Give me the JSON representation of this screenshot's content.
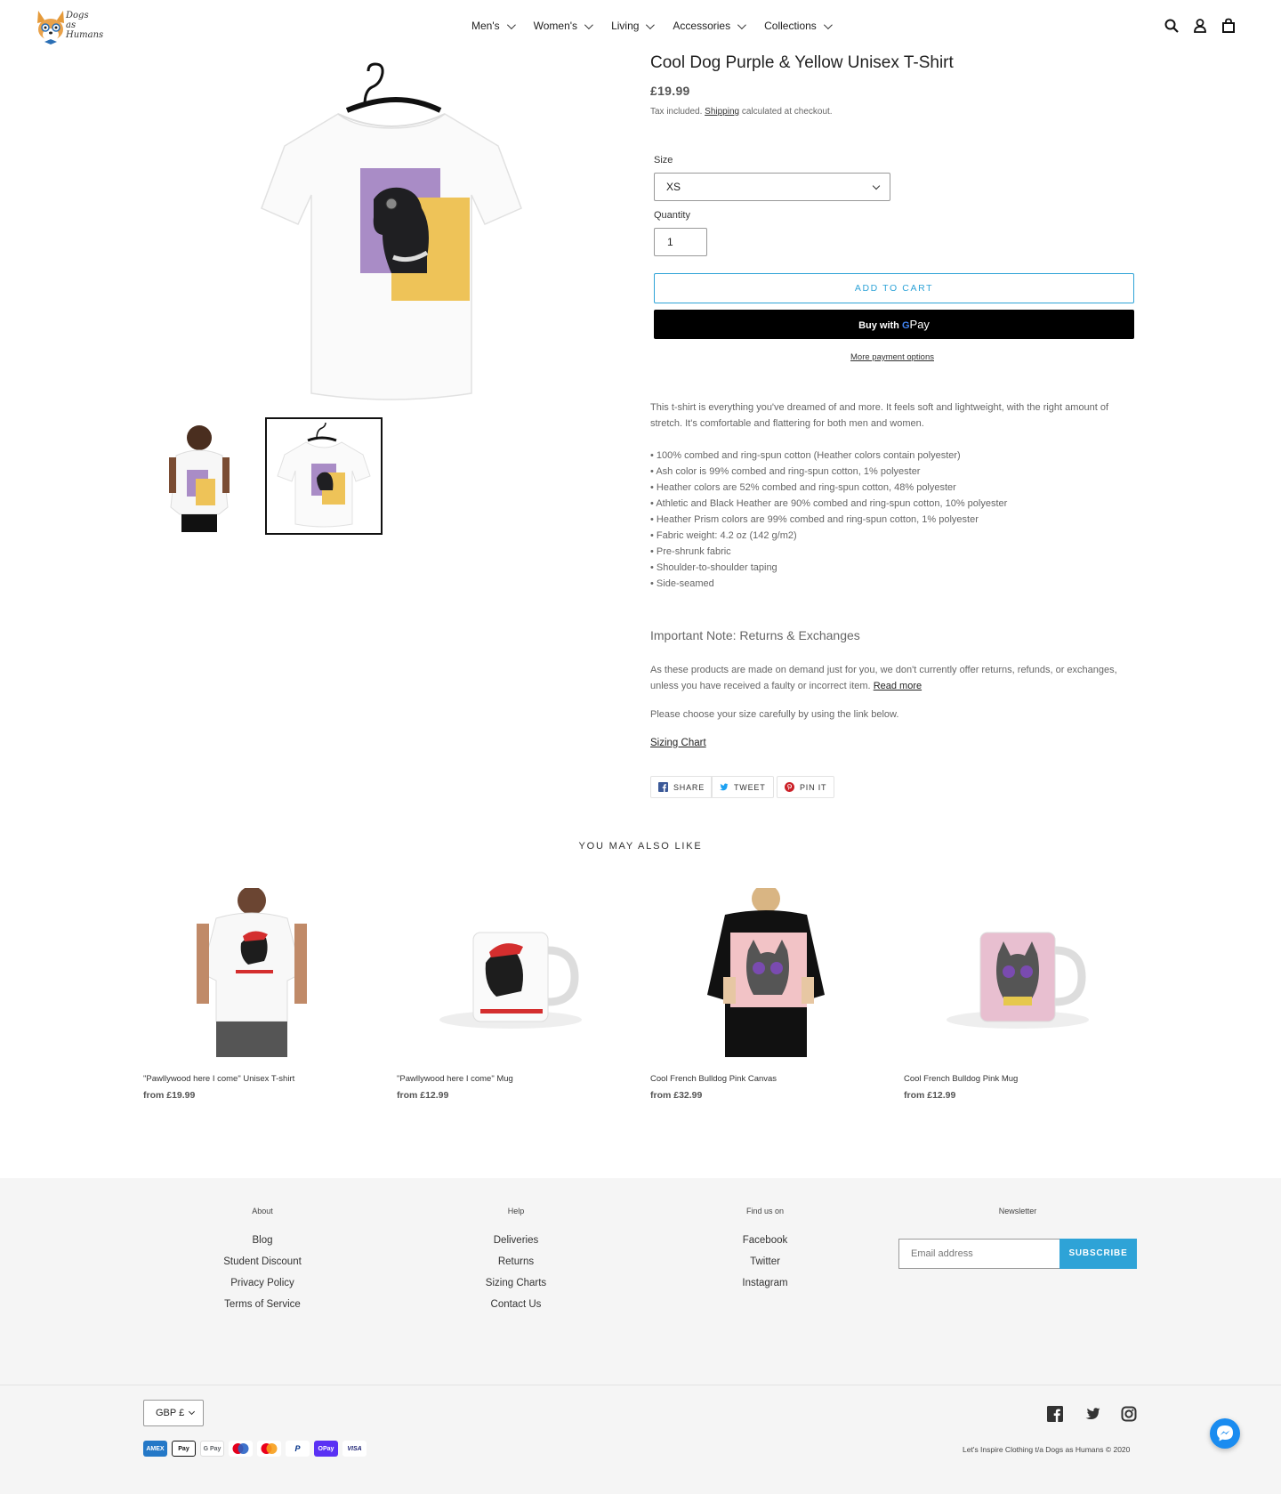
{
  "nav": {
    "items": [
      {
        "label": "Men's"
      },
      {
        "label": "Women's"
      },
      {
        "label": "Living"
      },
      {
        "label": "Accessories"
      },
      {
        "label": "Collections"
      }
    ]
  },
  "logo": {
    "line1": "Dogs",
    "line2": "as",
    "line3": "Humans"
  },
  "product": {
    "title": "Cool Dog Purple & Yellow Unisex T-Shirt",
    "price": "£19.99",
    "tax_prefix": "Tax included.",
    "tax_link": "Shipping",
    "tax_suffix": "calculated at checkout.",
    "size_label": "Size",
    "size_value": "XS",
    "quantity_label": "Quantity",
    "quantity_value": "1",
    "add_to_cart": "ADD TO CART",
    "buy_with": "Buy with",
    "gpay": "Pay",
    "more_payment": "More payment options",
    "description": "This t-shirt is everything you've dreamed of and more. It feels soft and lightweight, with the right amount of stretch. It's comfortable and flattering for both men and women.",
    "bullets": [
      "100% combed and ring-spun cotton (Heather colors contain polyester)",
      "Ash color is 99% combed and ring-spun cotton, 1% polyester",
      "Heather colors are 52% combed and ring-spun cotton, 48% polyester",
      "Athletic and Black Heather are 90% combed and ring-spun cotton, 10% polyester",
      "Heather Prism colors are 99% combed and ring-spun cotton, 1% polyester",
      "Fabric weight: 4.2 oz (142 g/m2)",
      "Pre-shrunk fabric",
      "Shoulder-to-shoulder taping",
      "Side-seamed"
    ],
    "note_title": "Important Note: Returns & Exchanges",
    "note_text": "As these products are made on demand just for you, we don't currently offer returns, refunds, or exchanges, unless you have received a faulty  or incorrect item.",
    "read_more": "Read more",
    "size_hint": "Please choose your size carefully by using the link below.",
    "sizing_chart": "Sizing Chart",
    "share": "SHARE",
    "tweet": "TWEET",
    "pin": "PIN IT"
  },
  "related": {
    "title": "YOU MAY ALSO LIKE",
    "items": [
      {
        "name": "\"Pawllywood here I come\" Unisex T-shirt",
        "price": "from £19.99"
      },
      {
        "name": "\"Pawllywood here I come\" Mug",
        "price": "from £12.99"
      },
      {
        "name": "Cool French Bulldog Pink Canvas",
        "price": "from £32.99"
      },
      {
        "name": "Cool French Bulldog Pink Mug",
        "price": "from £12.99"
      }
    ]
  },
  "footer": {
    "about": {
      "title": "About",
      "links": [
        "Blog",
        "Student Discount",
        "Privacy Policy",
        "Terms of Service"
      ]
    },
    "help": {
      "title": "Help",
      "links": [
        "Deliveries",
        "Returns",
        "Sizing Charts",
        "Contact Us"
      ]
    },
    "find": {
      "title": "Find us on",
      "links": [
        "Facebook",
        "Twitter",
        "Instagram"
      ]
    },
    "newsletter": {
      "title": "Newsletter",
      "placeholder": "Email address",
      "button": "SUBSCRIBE"
    },
    "currency": "GBP £",
    "payments": [
      "AMEX",
      "Pay",
      "G Pay",
      "",
      "",
      "P",
      "OPay",
      "VISA"
    ],
    "copyright": "Let's Inspire Clothing t/a Dogs as Humans © 2020"
  },
  "colors": {
    "accent": "#2ea3d7",
    "purple": "#a98cc6",
    "yellow": "#eec358"
  }
}
